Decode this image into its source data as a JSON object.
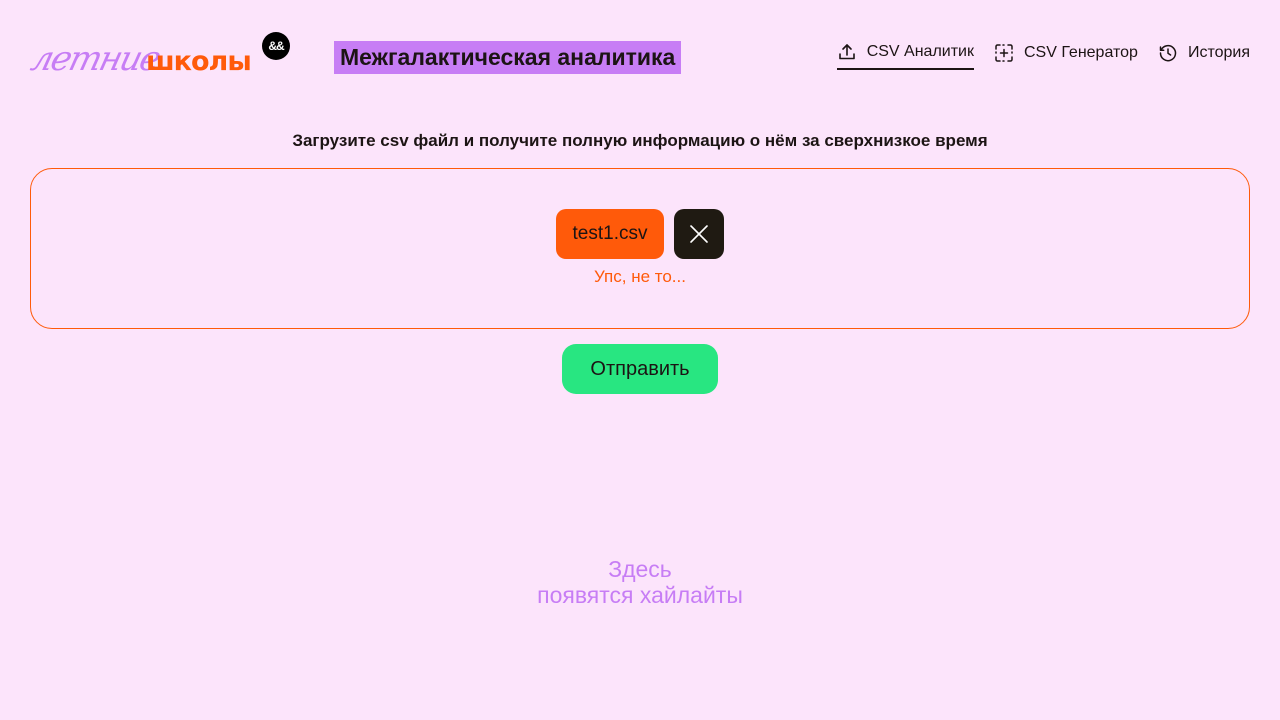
{
  "header": {
    "logo": {
      "part1": "летние",
      "part2": "школы",
      "badge": "&&"
    },
    "app_title": "Межгалактическая аналитика",
    "nav": [
      {
        "label": "CSV Аналитик",
        "icon": "upload-icon",
        "active": true
      },
      {
        "label": "CSV Генератор",
        "icon": "generate-icon",
        "active": false
      },
      {
        "label": "История",
        "icon": "history-icon",
        "active": false
      }
    ]
  },
  "main": {
    "subtitle": "Загрузите csv файл и получите полную информацию о нём за сверхнизкое время",
    "upload": {
      "file_name": "test1.csv",
      "remove_icon": "close-icon",
      "error": "Упс, не то..."
    },
    "submit_label": "Отправить",
    "highlights": {
      "line1": "Здесь",
      "line2": "появятся хайлайты"
    }
  },
  "colors": {
    "background": "#fce4fb",
    "accent_purple": "#c77df5",
    "accent_orange": "#ff5a0a",
    "accent_green": "#28e681",
    "dark": "#1f1a12"
  }
}
